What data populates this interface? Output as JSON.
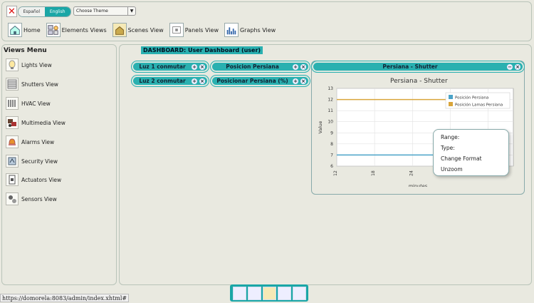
{
  "header": {
    "lang_es": "Español",
    "lang_en": "English",
    "theme_placeholder": "Choose Theme"
  },
  "nav": [
    {
      "label": "Home",
      "icon": "home-icon"
    },
    {
      "label": "Elements Views",
      "icon": "elements-icon"
    },
    {
      "label": "Scenes View",
      "icon": "scenes-icon"
    },
    {
      "label": "Panels View",
      "icon": "panels-icon"
    },
    {
      "label": "Graphs View",
      "icon": "graphs-icon"
    }
  ],
  "sidebar": {
    "title": "Views Menu",
    "items": [
      {
        "label": "Lights View",
        "icon": "light-bulb-icon"
      },
      {
        "label": "Shutters View",
        "icon": "shutter-icon"
      },
      {
        "label": "HVAC View",
        "icon": "radiator-icon"
      },
      {
        "label": "Multimedia View",
        "icon": "multimedia-icon"
      },
      {
        "label": "Alarms View",
        "icon": "bell-icon"
      },
      {
        "label": "Security View",
        "icon": "security-icon"
      },
      {
        "label": "Actuators View",
        "icon": "actuator-icon"
      },
      {
        "label": "Sensors View",
        "icon": "sensor-icon"
      }
    ]
  },
  "dashboard": {
    "title": "DASHBOARD: User Dashboard (user)",
    "widgets": [
      {
        "label": "Luz 1 conmutar"
      },
      {
        "label": "Posicion Persiana"
      },
      {
        "label": "Luz 2 conmutar"
      },
      {
        "label": "Posicionar Persiana (%)"
      }
    ],
    "chart_panel_title": "Persiana - Shutter"
  },
  "chart_data": {
    "type": "line",
    "title": "Persiana - Shutter",
    "xlabel": "minutes",
    "ylabel": "Value",
    "x_ticks": [
      "12",
      "18",
      "24",
      "30",
      "36"
    ],
    "y_ticks": [
      "6",
      "7",
      "8",
      "9",
      "10",
      "11",
      "12",
      "13"
    ],
    "ylim": [
      6,
      13
    ],
    "grid": true,
    "legend_position": "top-right",
    "series": [
      {
        "name": "Posición Persiana",
        "color": "#4aa3c8",
        "x": [
          12,
          36
        ],
        "y": [
          7,
          7
        ]
      },
      {
        "name": "Posición Lamas Persiana",
        "color": "#d9a53b",
        "x": [
          12,
          36
        ],
        "y": [
          12,
          12
        ]
      }
    ]
  },
  "context_menu": {
    "items": [
      "Range:",
      "Type:",
      "Change Format",
      "Unzoom"
    ]
  },
  "status_bar": {
    "url": "https://domorela:8083/admin/index.xhtml#"
  },
  "colors": {
    "accent": "#2ab0b0",
    "close": "#d11111"
  }
}
